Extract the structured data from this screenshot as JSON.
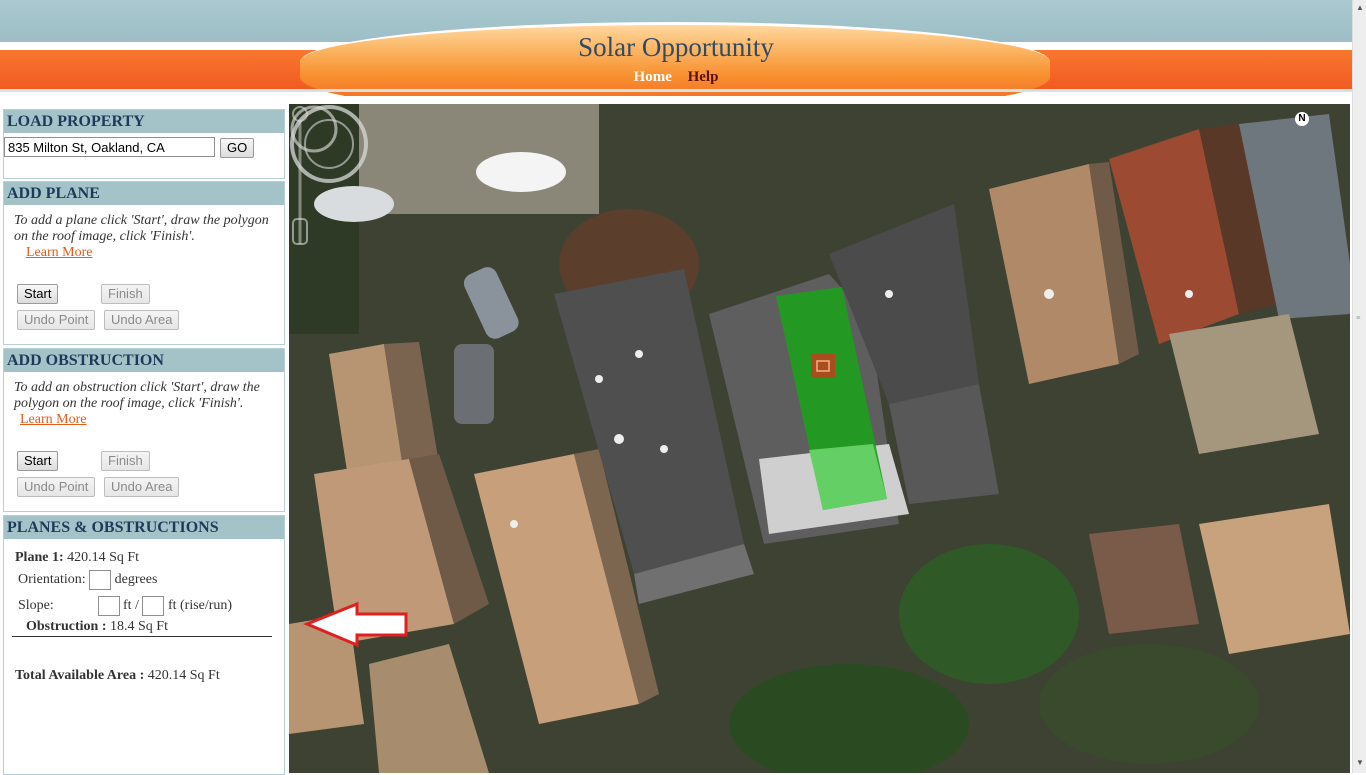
{
  "site": {
    "title": "Solar Opportunity",
    "nav": {
      "home": "Home",
      "help": "Help"
    }
  },
  "load_property": {
    "title": "LOAD PROPERTY",
    "address_value": "835 Milton St, Oakland, CA",
    "go_label": "GO"
  },
  "add_plane": {
    "title": "ADD PLANE",
    "help": "To add a plane click 'Start', draw the polygon on the roof image, click 'Finish'.",
    "learn_more": "Learn More",
    "start": "Start",
    "finish": "Finish",
    "undo_point": "Undo Point",
    "undo_area": "Undo Area"
  },
  "add_obstruction": {
    "title": "ADD OBSTRUCTION",
    "help": "To add an obstruction click 'Start', draw the polygon on the roof image, click 'Finish'.",
    "learn_more": "Learn More",
    "start": "Start",
    "finish": "Finish",
    "undo_point": "Undo Point",
    "undo_area": "Undo Area"
  },
  "planes_obstructions": {
    "title": "PLANES & OBSTRUCTIONS",
    "plane_label": "Plane 1:",
    "plane_area": "420.14 Sq Ft",
    "orientation_label": "Orientation:",
    "orientation_unit": "degrees",
    "slope_label": "Slope:",
    "slope_unit_1": "ft /",
    "slope_unit_2": "ft (rise/run)",
    "obstruction_label": "Obstruction :",
    "obstruction_area": "18.4 Sq Ft",
    "total_label": "Total Available Area :",
    "total_area": "420.14 Sq Ft"
  },
  "map": {
    "compass_letter": "N",
    "plane_color": "#1e9e1e",
    "obstruction_color": "#c2401c",
    "arrow_color": "#e02020"
  },
  "colors": {
    "header_orange": "#f15a22",
    "panel_title_bg": "#a4c3c9",
    "panel_title_text": "#1d3a5a",
    "link": "#e25c1c"
  }
}
